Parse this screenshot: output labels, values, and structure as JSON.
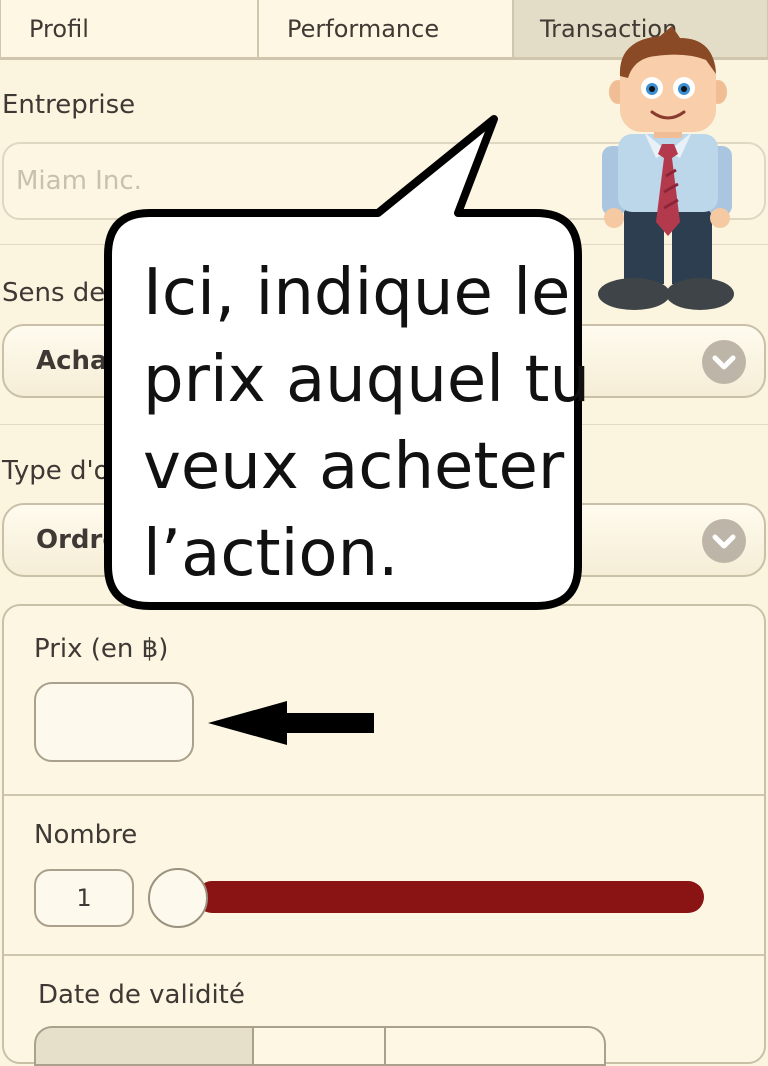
{
  "tabs": [
    {
      "label": "Profil"
    },
    {
      "label": "Performance"
    },
    {
      "label": "Transaction"
    }
  ],
  "form": {
    "company_label": "Entreprise",
    "company_placeholder": "Miam Inc.",
    "direction_label": "Sens de",
    "direction_value": "Achat",
    "order_type_label": "Type d'o",
    "order_type_value": "Ordre",
    "price_label": "Prix (en ฿)",
    "price_value": "",
    "quantity_label": "Nombre",
    "quantity_value": "1",
    "validity_label": "Date de validité"
  },
  "tutorial": {
    "bubble_lines": [
      "Ici, indique le",
      "prix auquel tu",
      "veux acheter",
      "l’action."
    ]
  },
  "colors": {
    "background": "#fbf4df",
    "slider_fill": "#8a1414",
    "chevron": "#bdb6a8"
  },
  "icons": {
    "select_chevron": "chevron-down-icon",
    "pointer_arrow": "arrow-left-icon",
    "mascot": "businessman-character"
  }
}
